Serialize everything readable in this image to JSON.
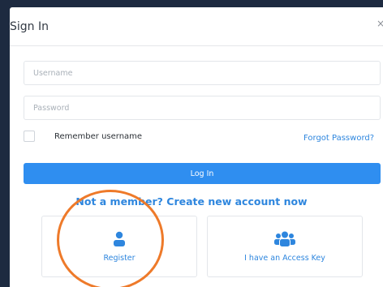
{
  "modal": {
    "title": "Sign In",
    "close_glyph": "×"
  },
  "form": {
    "username_placeholder": "Username",
    "password_placeholder": "Password",
    "remember_label": "Remember username",
    "forgot_label": "Forgot Password?",
    "login_label": "Log In",
    "create_account_label": "Not a member? Create new account now"
  },
  "options": [
    {
      "label": "Register",
      "icon": "user-icon"
    },
    {
      "label": "I have an Access Key",
      "icon": "users-group-icon"
    }
  ],
  "colors": {
    "accent": "#2f8ef0",
    "link": "#2e86de",
    "annotation": "#ee7a2a",
    "backdrop": "#1d2a40"
  }
}
